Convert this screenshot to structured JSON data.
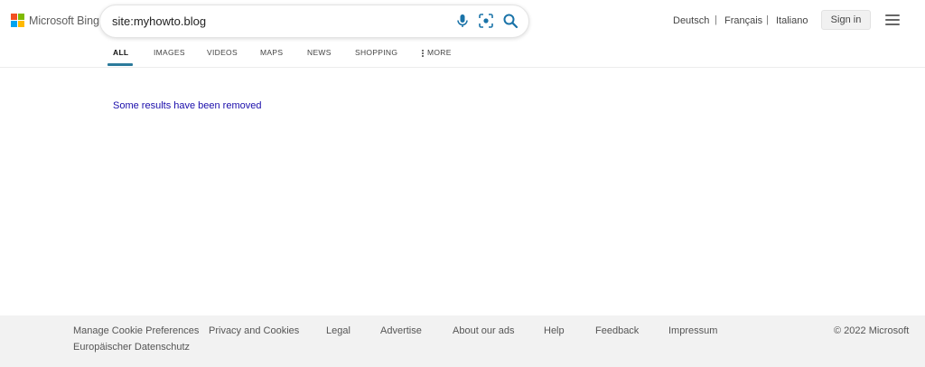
{
  "brand": {
    "name": "Microsoft Bing",
    "square_colors": [
      "#f25022",
      "#7fba00",
      "#00a4ef",
      "#ffb900"
    ]
  },
  "search": {
    "query": "site:myhowto.blog"
  },
  "languages": [
    "Deutsch",
    "Français",
    "Italiano"
  ],
  "sign_in_label": "Sign in",
  "tabs": [
    {
      "label": "ALL",
      "active": true
    },
    {
      "label": "IMAGES"
    },
    {
      "label": "VIDEOS"
    },
    {
      "label": "MAPS"
    },
    {
      "label": "NEWS"
    },
    {
      "label": "SHOPPING"
    },
    {
      "label": "MORE"
    }
  ],
  "results": {
    "notice": "Some results have been removed"
  },
  "footer": {
    "links": [
      "Manage Cookie Preferences",
      "Privacy and Cookies",
      "Legal",
      "Advertise",
      "About our ads",
      "Help",
      "Feedback",
      "Impressum",
      "Europäischer Datenschutz"
    ],
    "copyright": "© 2022 Microsoft"
  },
  "colors": {
    "accent": "#2b7a9b",
    "icon_blue": "#1a73a8",
    "link_blue": "#1a0dab",
    "footer_bg": "#f2f2f2"
  }
}
